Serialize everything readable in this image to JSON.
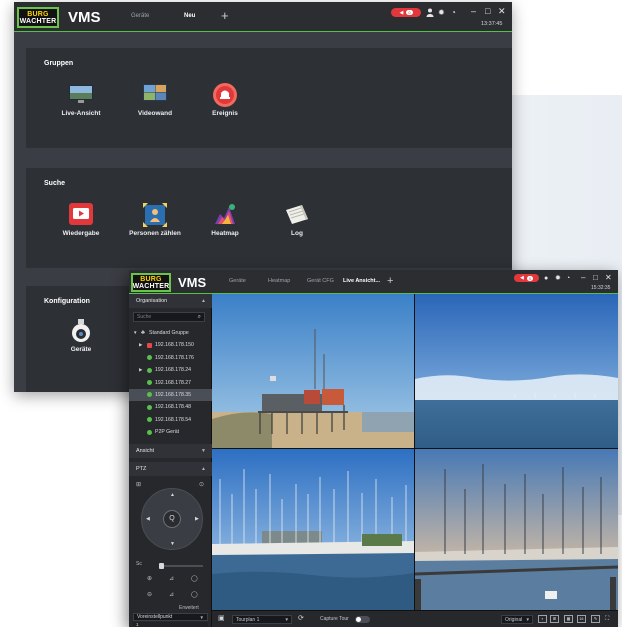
{
  "colors": {
    "accent": "#53c14a",
    "alarm": "#e2383b",
    "logo_yellow": "#ffd400",
    "window_bg": "#3a3d43",
    "card_bg": "#2d3035"
  },
  "back_window": {
    "logo": {
      "line1": "BURG",
      "line2": "WACHTER"
    },
    "app_name": "VMS",
    "tabs": [
      {
        "label": "Geräte",
        "active": false
      },
      {
        "label": "Neu",
        "active": true
      }
    ],
    "add_tab": "+",
    "alarm": {
      "icon": "speaker-icon",
      "count": "0"
    },
    "toolbar_icons": [
      "user-icon",
      "gear-icon",
      "gauge-icon"
    ],
    "window_controls": [
      "–",
      "□",
      "✕"
    ],
    "clock": "13:37:45",
    "sections": [
      {
        "title": "Gruppen",
        "tiles": [
          {
            "label": "Live-Ansicht",
            "icon": "live-view-icon"
          },
          {
            "label": "Videowand",
            "icon": "videowall-icon"
          },
          {
            "label": "Ereignis",
            "icon": "event-alarm-icon"
          }
        ]
      },
      {
        "title": "Suche",
        "tiles": [
          {
            "label": "Wiedergabe",
            "icon": "playback-icon"
          },
          {
            "label": "Personen zählen",
            "icon": "people-counting-icon"
          },
          {
            "label": "Heatmap",
            "icon": "heatmap-icon"
          },
          {
            "label": "Log",
            "icon": "log-icon"
          }
        ]
      },
      {
        "title": "Konfiguration",
        "tiles": [
          {
            "label": "Geräte",
            "icon": "device-camera-icon"
          }
        ]
      }
    ]
  },
  "front_window": {
    "logo": {
      "line1": "BURG",
      "line2": "WACHTER"
    },
    "app_name": "VMS",
    "tabs": [
      {
        "label": "Geräte",
        "active": false
      },
      {
        "label": "Heatmap",
        "active": false
      },
      {
        "label": "Gerät CFG",
        "active": false
      },
      {
        "label": "Live Ansicht...",
        "active": true
      }
    ],
    "add_tab": "+",
    "alarm": {
      "count": "0"
    },
    "window_controls": [
      "–",
      "□",
      "✕"
    ],
    "clock": "15:32:35",
    "sidebar": {
      "org_header": "Organisation",
      "search_placeholder": "Suche",
      "tree": [
        {
          "label": "Standard Gruppe",
          "level": 0,
          "kind": "group",
          "expanded": true
        },
        {
          "label": "192.168.178.150",
          "level": 1,
          "kind": "nvr",
          "expandable": true
        },
        {
          "label": "192.168.178.176",
          "level": 1,
          "kind": "camera"
        },
        {
          "label": "192.168.178.24",
          "level": 1,
          "kind": "camera",
          "expandable": true
        },
        {
          "label": "192.168.178.27",
          "level": 1,
          "kind": "camera"
        },
        {
          "label": "192.168.178.35",
          "level": 1,
          "kind": "camera",
          "selected": true
        },
        {
          "label": "192.168.178.48",
          "level": 1,
          "kind": "camera"
        },
        {
          "label": "192.168.178.54",
          "level": 1,
          "kind": "camera"
        },
        {
          "label": "P2P Gerät",
          "level": 1,
          "kind": "camera"
        }
      ],
      "view_header": "Ansicht",
      "ptz_header": "PTZ",
      "ptz_center": "Q",
      "speed_label": "Sc",
      "advanced_label": "Erweitert",
      "preset_label": "Voreinstellpunkt",
      "preset_value": "1"
    },
    "bottom_bar": {
      "preset_tour": "Tourplan 1",
      "capture_label": "Capture Tour",
      "stream_select": "Original",
      "layouts": [
        "1x1",
        "2x2",
        "3x3",
        "16"
      ]
    }
  }
}
